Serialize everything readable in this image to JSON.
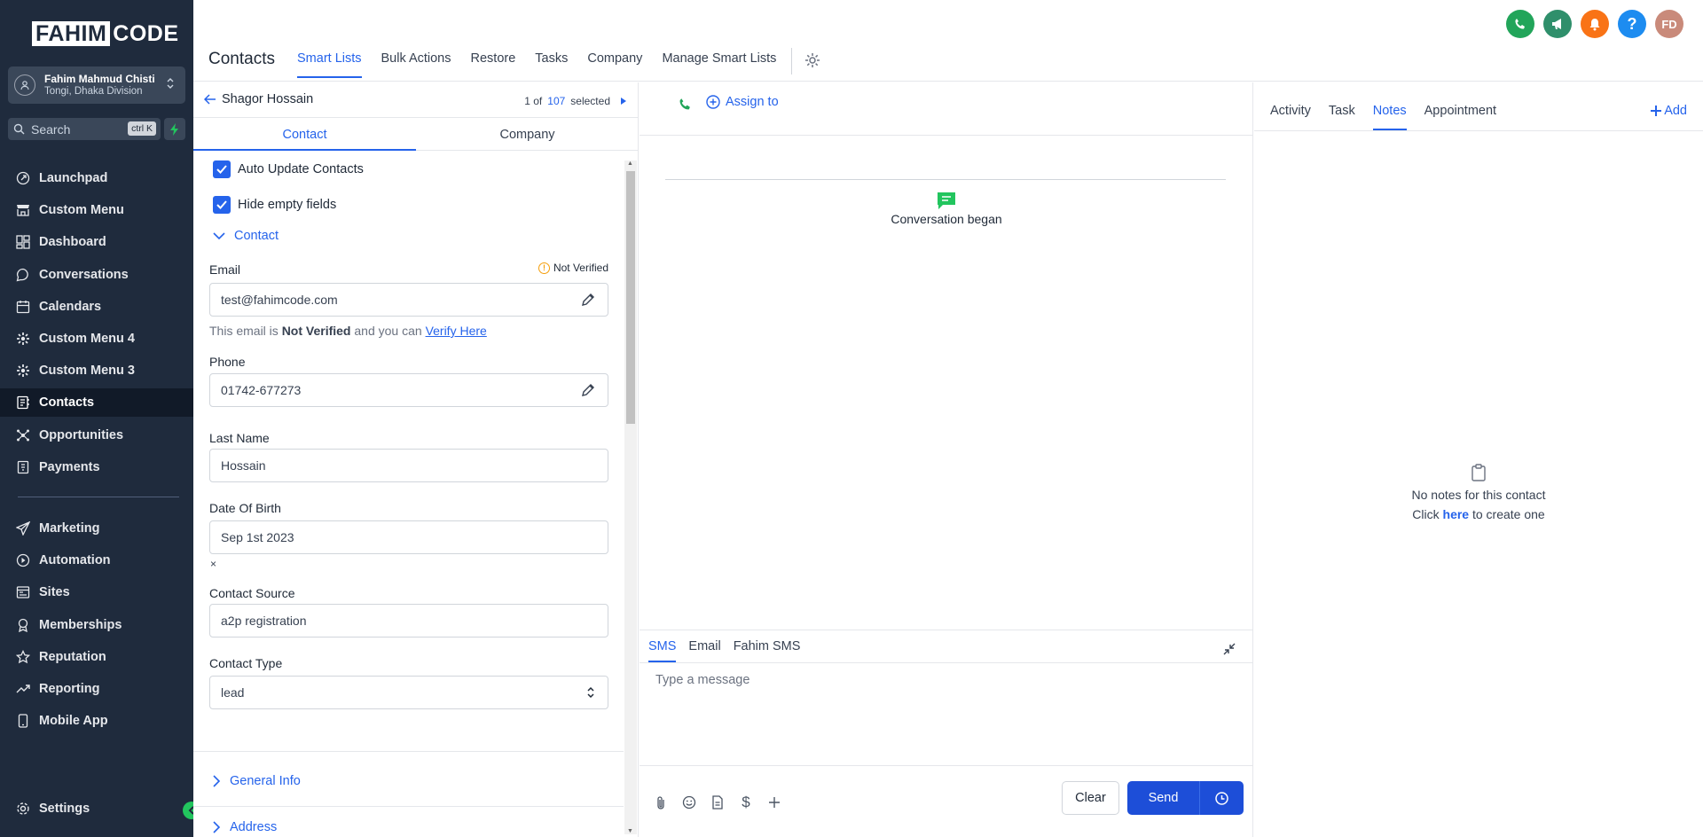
{
  "brand": {
    "logo_box": "FAHIM",
    "logo_rest": "CODE"
  },
  "account": {
    "name": "Fahim Mahmud Chisti",
    "location": "Tongi, Dhaka Division"
  },
  "search": {
    "label": "Search",
    "shortcut": "ctrl K"
  },
  "sidebar": {
    "items": [
      {
        "label": "Launchpad",
        "icon": "rocket-icon"
      },
      {
        "label": "Custom Menu",
        "icon": "store-icon"
      },
      {
        "label": "Dashboard",
        "icon": "grid-icon"
      },
      {
        "label": "Conversations",
        "icon": "chat-icon"
      },
      {
        "label": "Calendars",
        "icon": "calendar-icon"
      },
      {
        "label": "Custom Menu 4",
        "icon": "gear-icon"
      },
      {
        "label": "Custom Menu 3",
        "icon": "gear-icon"
      },
      {
        "label": "Contacts",
        "icon": "contacts-icon",
        "active": true
      },
      {
        "label": "Opportunities",
        "icon": "opportunities-icon"
      },
      {
        "label": "Payments",
        "icon": "payments-icon"
      }
    ],
    "items2": [
      {
        "label": "Marketing",
        "icon": "send-icon"
      },
      {
        "label": "Automation",
        "icon": "automation-icon"
      },
      {
        "label": "Sites",
        "icon": "sites-icon"
      },
      {
        "label": "Memberships",
        "icon": "membership-icon"
      },
      {
        "label": "Reputation",
        "icon": "star-icon"
      },
      {
        "label": "Reporting",
        "icon": "trend-icon"
      },
      {
        "label": "Mobile App",
        "icon": "mobile-icon"
      }
    ],
    "settings": "Settings"
  },
  "header": {
    "title": "Contacts",
    "tabs": [
      "Smart Lists",
      "Bulk Actions",
      "Restore",
      "Tasks",
      "Company",
      "Manage Smart Lists"
    ],
    "avatar_initials": "FD",
    "colors": {
      "phone": "#22a55a",
      "megaphone": "#2f8f6b",
      "bell": "#f97316",
      "help": "#1d8cf0",
      "avatar": "#c98a7a"
    }
  },
  "contact_panel": {
    "name": "Shagor Hossain",
    "pager": {
      "current": "1 of",
      "total": "107",
      "suffix": "selected"
    },
    "tabs": [
      "Contact",
      "Company"
    ],
    "auto_update": "Auto Update Contacts",
    "hide_empty": "Hide empty fields",
    "section_contact": "Contact",
    "email": {
      "label": "Email",
      "value": "test@fahimcode.com",
      "status": "Not Verified"
    },
    "email_hint": {
      "pre": "This email is",
      "bold": "Not Verified",
      "mid": "and you can",
      "link": "Verify Here"
    },
    "phone": {
      "label": "Phone",
      "value": "01742-677273"
    },
    "last_name": {
      "label": "Last Name",
      "value": "Hossain"
    },
    "dob": {
      "label": "Date Of Birth",
      "value": "Sep 1st 2023",
      "clear": "×"
    },
    "source": {
      "label": "Contact Source",
      "value": "a2p registration"
    },
    "type": {
      "label": "Contact Type",
      "value": "lead"
    },
    "section_general": "General Info",
    "section_address": "Address"
  },
  "conversation": {
    "assign": "Assign to",
    "began": "Conversation began",
    "tabs": [
      "SMS",
      "Email",
      "Fahim SMS"
    ],
    "placeholder": "Type a message",
    "clear": "Clear",
    "send": "Send"
  },
  "notes_panel": {
    "tabs": [
      "Activity",
      "Task",
      "Notes",
      "Appointment"
    ],
    "add": "Add",
    "empty_line1": "No notes for this contact",
    "empty_pre": "Click",
    "empty_link": "here",
    "empty_post": "to create one"
  }
}
